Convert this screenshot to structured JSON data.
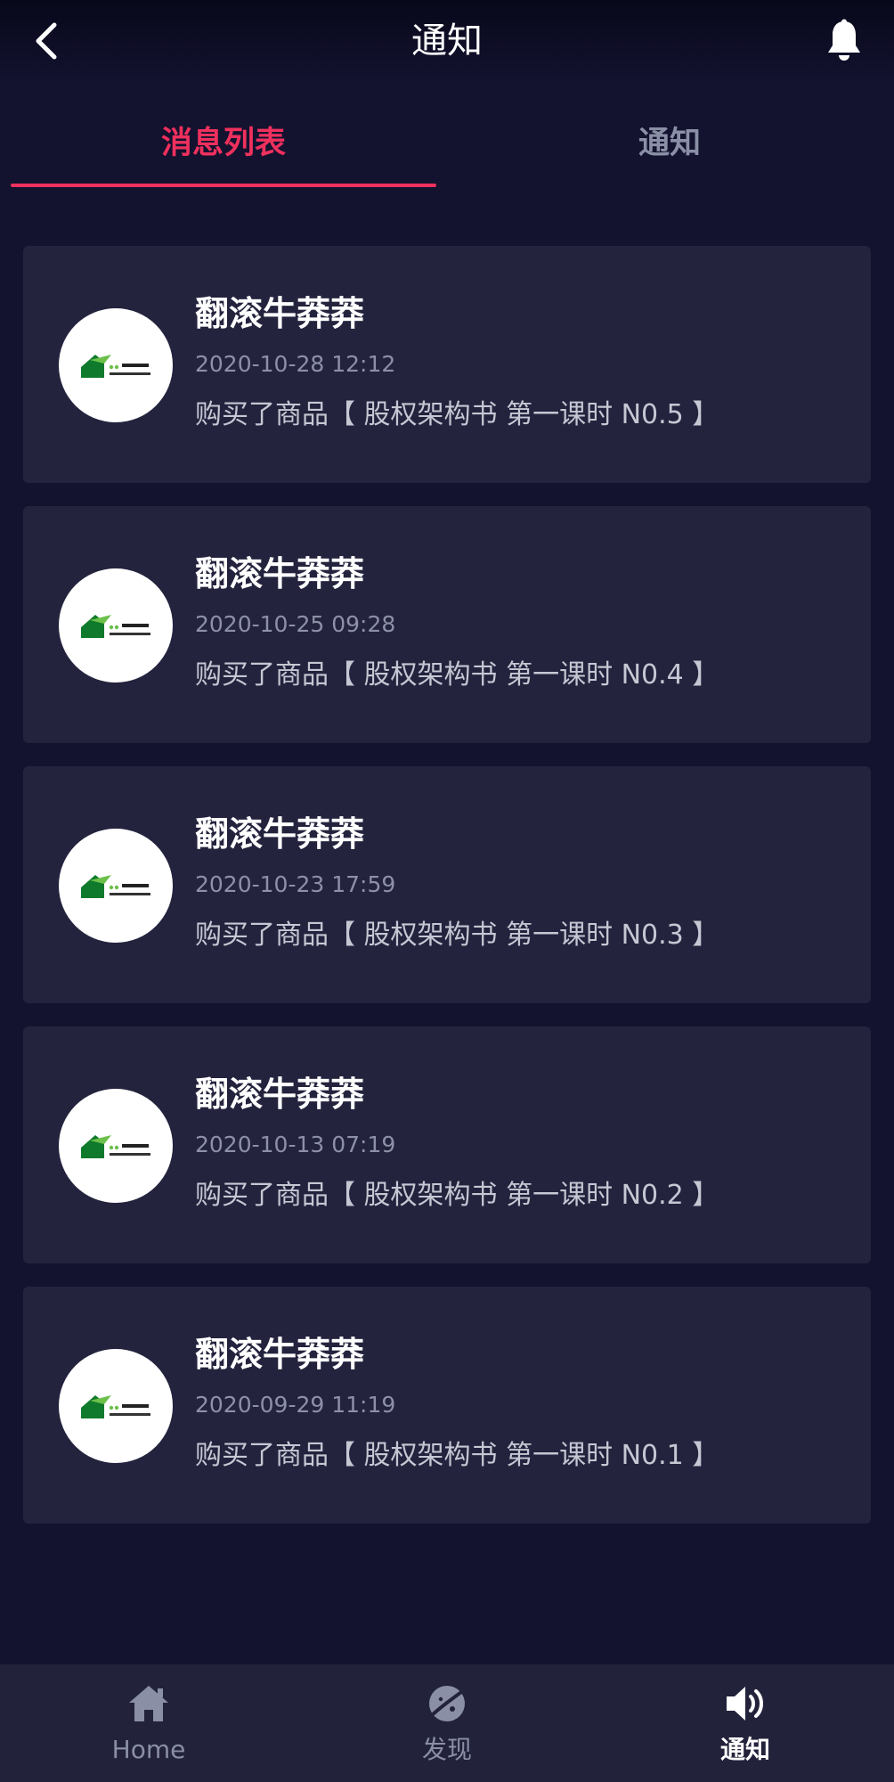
{
  "header": {
    "title": "通知",
    "back_icon": "chevron-left-icon",
    "bell_icon": "bell-icon"
  },
  "tabs": [
    {
      "label": "消息列表",
      "active": true
    },
    {
      "label": "通知",
      "active": false
    }
  ],
  "colors": {
    "background": "#13122f",
    "card": "#23233e",
    "accent": "#f0305d",
    "muted": "#8a8fa6"
  },
  "messages": [
    {
      "name": "翻滚牛莽莽",
      "time": "2020-10-28 12:12",
      "text": "购买了商品【 股权架构书 第一课时 N0.5 】",
      "avatar_icon": "injection-house-logo-icon"
    },
    {
      "name": "翻滚牛莽莽",
      "time": "2020-10-25 09:28",
      "text": "购买了商品【 股权架构书 第一课时 N0.4 】",
      "avatar_icon": "injection-house-logo-icon"
    },
    {
      "name": "翻滚牛莽莽",
      "time": "2020-10-23 17:59",
      "text": "购买了商品【 股权架构书 第一课时 N0.3 】",
      "avatar_icon": "injection-house-logo-icon"
    },
    {
      "name": "翻滚牛莽莽",
      "time": "2020-10-13 07:19",
      "text": "购买了商品【 股权架构书 第一课时 N0.2 】",
      "avatar_icon": "injection-house-logo-icon"
    },
    {
      "name": "翻滚牛莽莽",
      "time": "2020-09-29 11:19",
      "text": "购买了商品【 股权架构书 第一课时 N0.1 】",
      "avatar_icon": "injection-house-logo-icon"
    }
  ],
  "bottom_nav": [
    {
      "label": "Home",
      "icon": "home-icon",
      "active": false
    },
    {
      "label": "发现",
      "icon": "planet-icon",
      "active": false
    },
    {
      "label": "通知",
      "icon": "speaker-icon",
      "active": true
    }
  ]
}
